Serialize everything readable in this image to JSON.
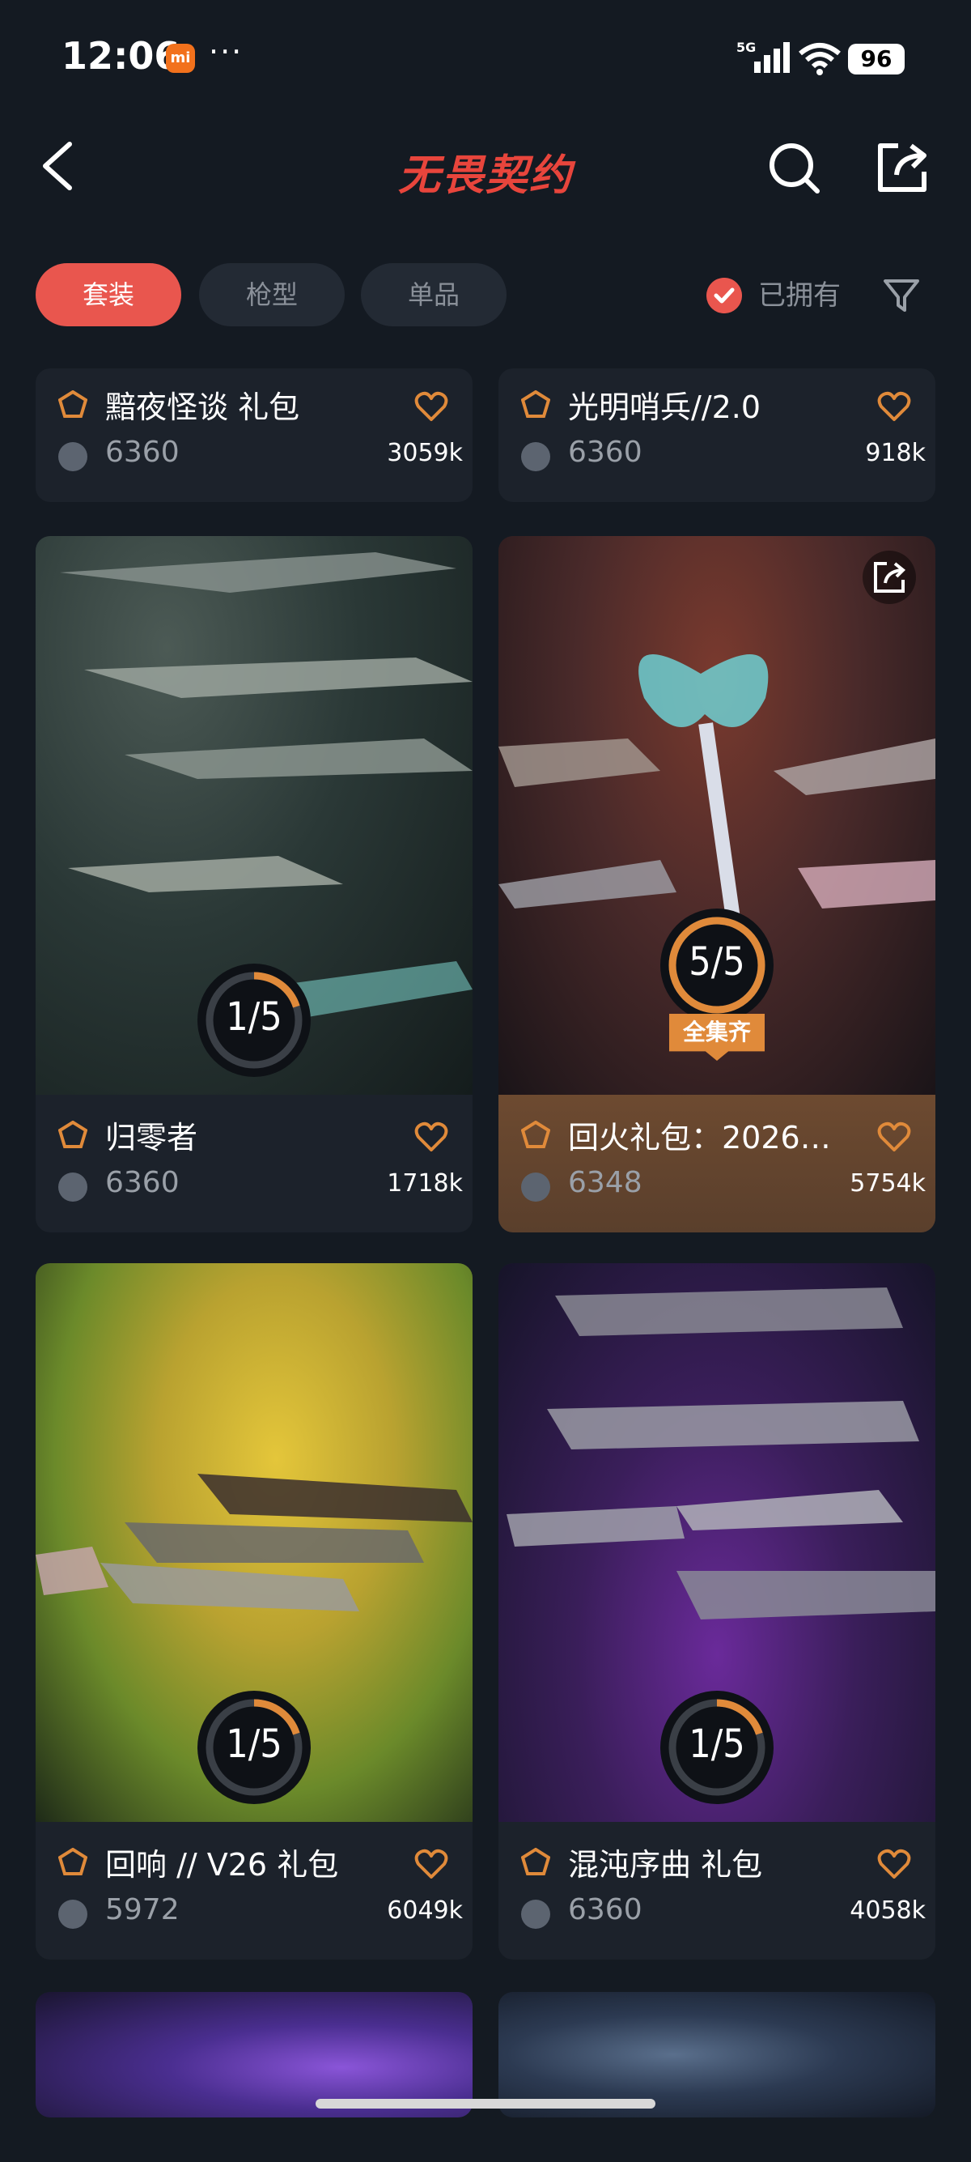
{
  "status_bar": {
    "time": "12:06",
    "mi_badge": "mi",
    "dots": "···",
    "network": "5G",
    "battery": "96"
  },
  "header": {
    "title": "无畏契约"
  },
  "tabs": [
    {
      "label": "套装",
      "active": true
    },
    {
      "label": "枪型",
      "active": false
    },
    {
      "label": "单品",
      "active": false
    }
  ],
  "owned_filter": {
    "label": "已拥有",
    "checked": true
  },
  "cards": [
    {
      "name": "黯夜怪谈 礼包",
      "price": "6360",
      "likes": "3059k"
    },
    {
      "name": "光明哨兵//2.0",
      "price": "6360",
      "likes": "918k"
    },
    {
      "name": "归零者",
      "price": "6360",
      "likes": "1718k",
      "progress": "1/5",
      "progress_value": 0.2
    },
    {
      "name": "回火礼包：2026…",
      "price": "6348",
      "likes": "5754k",
      "progress": "5/5",
      "progress_value": 1.0,
      "badge": "全集齐",
      "highlighted": true
    },
    {
      "name": "回响 // V26 礼包",
      "price": "5972",
      "likes": "6049k",
      "progress": "1/5",
      "progress_value": 0.2
    },
    {
      "name": "混沌序曲 礼包",
      "price": "6360",
      "likes": "4058k",
      "progress": "1/5",
      "progress_value": 0.2
    }
  ],
  "colors": {
    "accent": "#e9564e",
    "ring": "#e08a3a",
    "background": "#141a22"
  }
}
